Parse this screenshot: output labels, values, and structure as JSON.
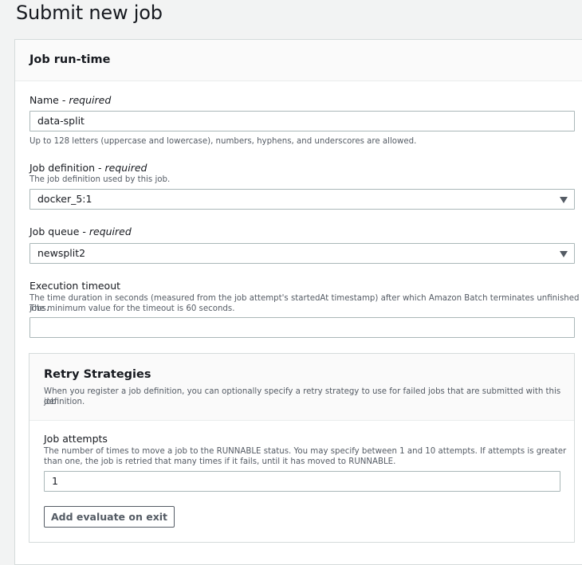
{
  "page": {
    "title": "Submit new job"
  },
  "panel": {
    "title": "Job run-time"
  },
  "name": {
    "label": "Name - ",
    "required": "required",
    "value": "data-split",
    "help": "Up to 128 letters (uppercase and lowercase), numbers, hyphens, and underscores are allowed."
  },
  "job_definition": {
    "label": "Job definition - ",
    "required": "required",
    "desc": "The job definition used by this job.",
    "value": "docker_5:1"
  },
  "job_queue": {
    "label": "Job queue - ",
    "required": "required",
    "value": "newsplit2"
  },
  "timeout": {
    "label": "Execution timeout",
    "desc_line1": "The time duration in seconds (measured from the job attempt's startedAt timestamp) after which Amazon Batch terminates unfinished jobs.",
    "desc_line2": "The minimum value for the timeout is 60 seconds.",
    "value": ""
  },
  "retry": {
    "title": "Retry Strategies",
    "desc_line1": "When you register a job definition, you can optionally specify a retry strategy to use for failed jobs that are submitted with this job",
    "desc_line2": "definition.",
    "attempts_label": "Job attempts",
    "attempts_desc_line1": "The number of times to move a job to the RUNNABLE status. You may specify between 1 and 10 attempts. If attempts is greater",
    "attempts_desc_line2": "than one, the job is retried that many times if it fails, until it has moved to RUNNABLE.",
    "attempts_value": "1",
    "add_button": "Add evaluate on exit"
  }
}
